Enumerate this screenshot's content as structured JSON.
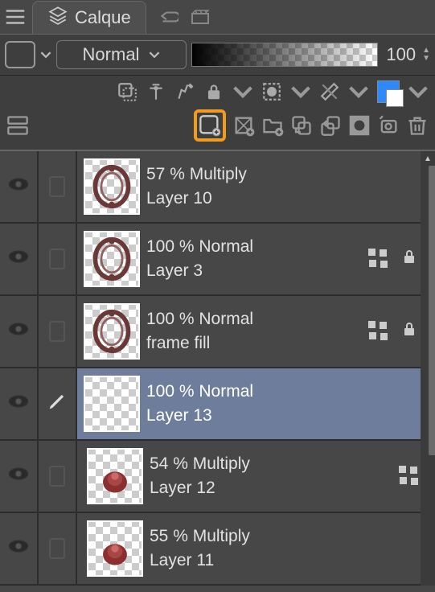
{
  "tab": {
    "label": "Calque"
  },
  "controls": {
    "blend_mode": "Normal",
    "opacity": "100"
  },
  "layers": [
    {
      "opacity": "57",
      "blend": "Multiply",
      "name": "Layer 10",
      "visible": true,
      "selected": false,
      "hasMask": false,
      "locked": false,
      "thumb": "frame1"
    },
    {
      "opacity": "100",
      "blend": "Normal",
      "name": "Layer 3",
      "visible": true,
      "selected": false,
      "hasMask": true,
      "locked": true,
      "thumb": "frame2"
    },
    {
      "opacity": "100",
      "blend": "Normal",
      "name": "frame fill",
      "visible": true,
      "selected": false,
      "hasMask": true,
      "locked": true,
      "thumb": "frame3"
    },
    {
      "opacity": "100",
      "blend": "Normal",
      "name": "Layer 13",
      "visible": true,
      "selected": true,
      "editing": true,
      "hasMask": false,
      "locked": false,
      "thumb": "empty"
    },
    {
      "opacity": "54",
      "blend": "Multiply",
      "name": "Layer 12",
      "visible": true,
      "selected": false,
      "hasMask": true,
      "locked": false,
      "thumb": "rose1",
      "offset": true
    },
    {
      "opacity": "55",
      "blend": "Multiply",
      "name": "Layer 11",
      "visible": true,
      "selected": false,
      "hasMask": false,
      "locked": false,
      "thumb": "rose2",
      "offset": true
    }
  ]
}
